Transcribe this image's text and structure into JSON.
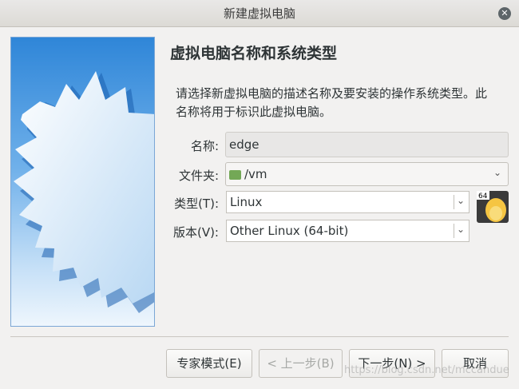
{
  "window": {
    "title": "新建虚拟电脑",
    "close_glyph": "✕"
  },
  "page": {
    "title": "虚拟电脑名称和系统类型",
    "description": "请选择新虚拟电脑的描述名称及要安装的操作系统类型。此名称将用于标识此虚拟电脑。"
  },
  "form": {
    "name_label": "名称:",
    "name_value": "edge",
    "folder_label": "文件夹:",
    "folder_value": "/vm",
    "type_label": "类型(T):",
    "type_value": "Linux",
    "version_label": "版本(V):",
    "version_value": "Other Linux (64-bit)",
    "os_icon_badge": "64"
  },
  "buttons": {
    "expert": "专家模式(E)",
    "back": "< 上一步(B)",
    "next": "下一步(N) >",
    "cancel": "取消"
  },
  "watermark": "https://blog.csdn.net/mccandue",
  "colors": {
    "accent_blue": "#2f86d8",
    "linux_tux": "#f5c542",
    "folder_green": "#73a856"
  }
}
